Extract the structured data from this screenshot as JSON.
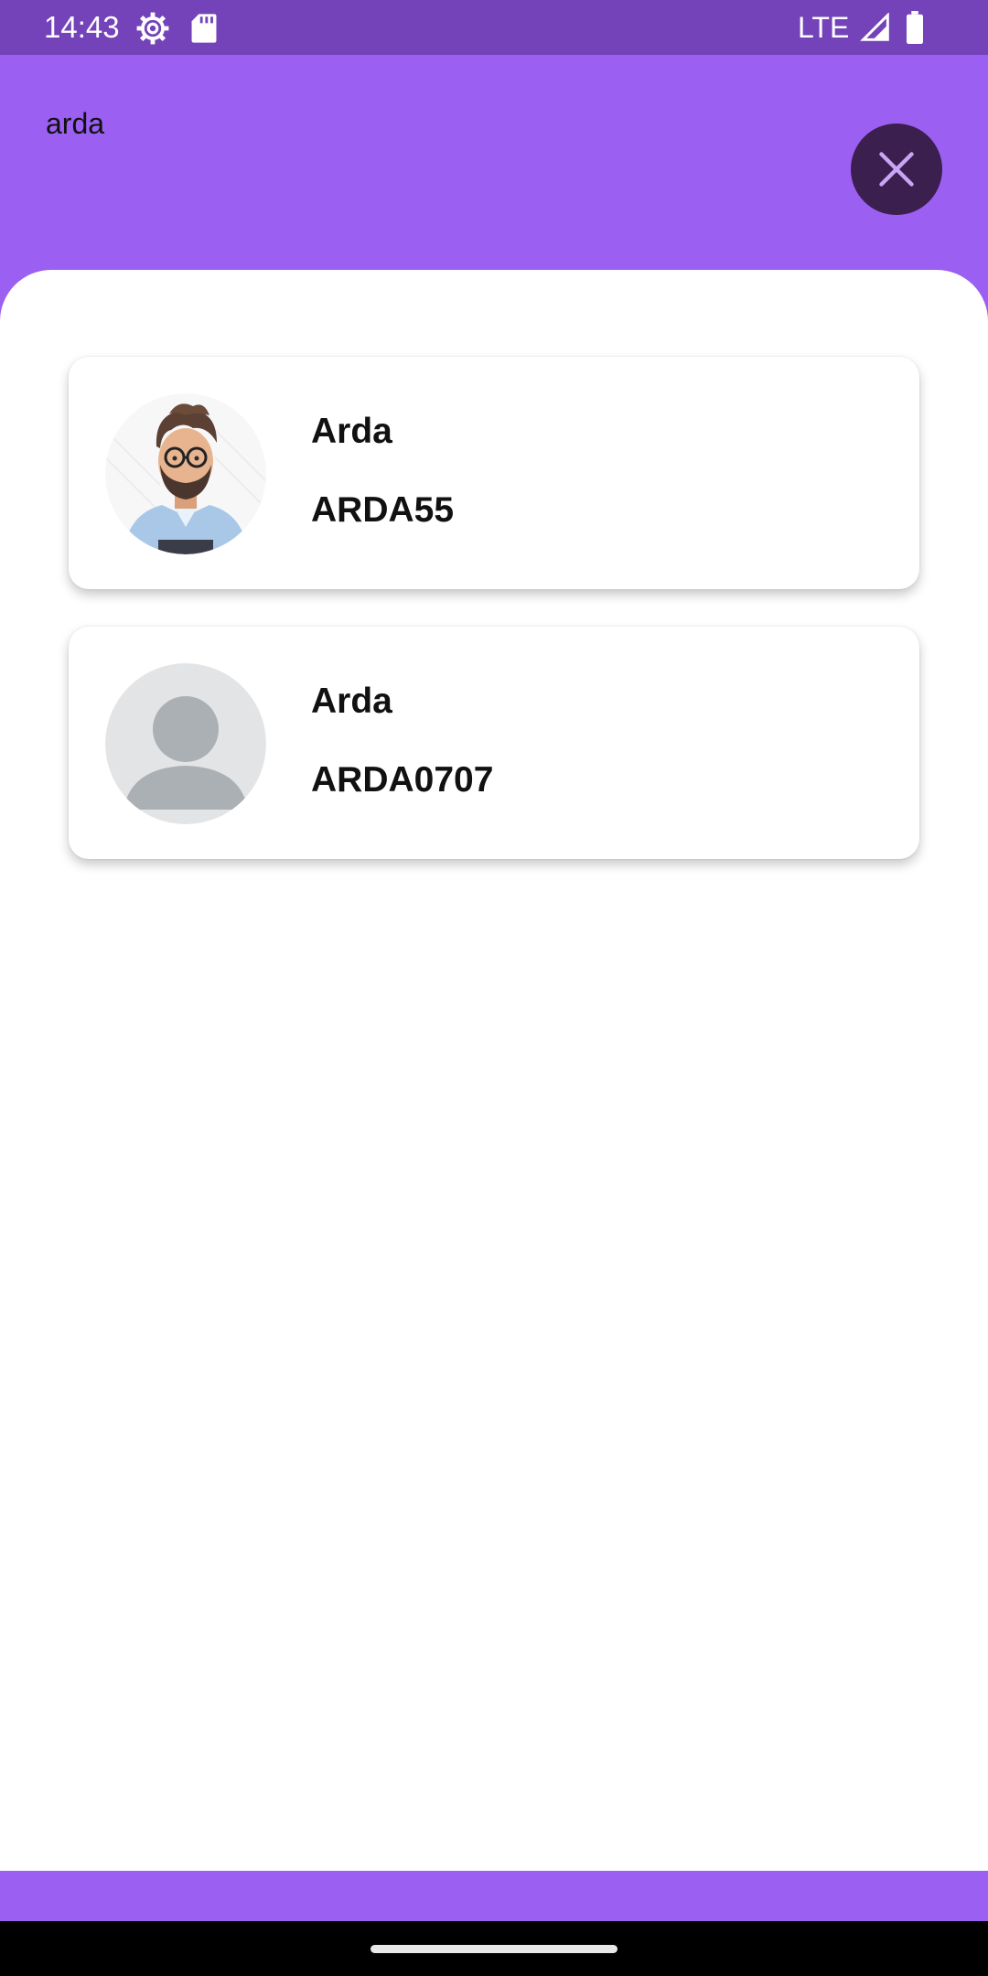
{
  "status_bar": {
    "time": "14:43",
    "network": "LTE",
    "icons": [
      "settings-gear-icon",
      "sd-card-icon",
      "signal-icon",
      "battery-icon"
    ]
  },
  "search": {
    "value": "arda",
    "close_icon": "close-icon"
  },
  "results": [
    {
      "name": "Arda",
      "username": "ARDA55",
      "avatar": "cartoon-man-with-glasses-avatar"
    },
    {
      "name": "Arda",
      "username": "ARDA0707",
      "avatar": "default-person-avatar"
    }
  ],
  "colors": {
    "primary": "#9b5ff2",
    "status_bar": "#7443b9",
    "close_button": "#3b1f4e",
    "close_icon": "#c9a6f5"
  }
}
